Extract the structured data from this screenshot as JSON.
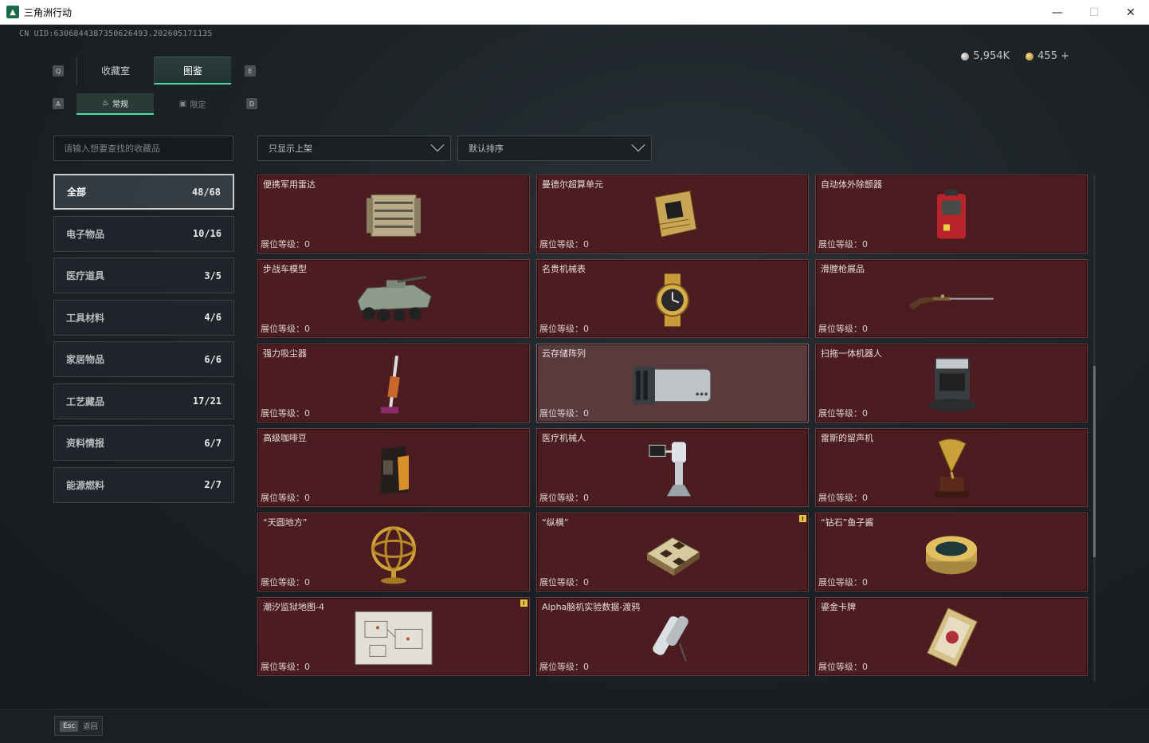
{
  "window": {
    "title": "三角洲行动"
  },
  "header": {
    "uid": "CN UID:6306844387350626493.202605171135",
    "currency": {
      "silver": "5,954K",
      "gold": "455 +"
    }
  },
  "key_hints": {
    "prev_tab": "Q",
    "next_tab": "E",
    "prev_sub": "A",
    "next_sub": "D"
  },
  "tabs": [
    {
      "label": "收藏室"
    },
    {
      "label": "图鉴"
    }
  ],
  "sub_tabs": [
    {
      "label": "常规"
    },
    {
      "label": "限定"
    }
  ],
  "search": {
    "placeholder": "请输入想要查找的收藏品"
  },
  "filters": {
    "shelf_filter": "只显示上架",
    "sort": "默认排序"
  },
  "categories": [
    {
      "label": "全部",
      "count": "48/68"
    },
    {
      "label": "电子物品",
      "count": "10/16"
    },
    {
      "label": "医疗道具",
      "count": "3/5"
    },
    {
      "label": "工具材料",
      "count": "4/6"
    },
    {
      "label": "家居物品",
      "count": "6/6"
    },
    {
      "label": "工艺藏品",
      "count": "17/21"
    },
    {
      "label": "资料情报",
      "count": "6/7"
    },
    {
      "label": "能源燃料",
      "count": "2/7"
    }
  ],
  "level_label": "展位等级：0",
  "items": [
    {
      "name": "便携军用雷达",
      "icon": "radar-icon"
    },
    {
      "name": "曼德尔超算单元",
      "icon": "chip-icon"
    },
    {
      "name": "自动体外除颤器",
      "icon": "defibrillator-icon"
    },
    {
      "name": "步战车模型",
      "icon": "ifv-model-icon"
    },
    {
      "name": "名贵机械表",
      "icon": "watch-icon"
    },
    {
      "name": "滑膛枪展品",
      "icon": "musket-icon"
    },
    {
      "name": "强力吸尘器",
      "icon": "vacuum-icon"
    },
    {
      "name": "云存储阵列",
      "icon": "storage-array-icon"
    },
    {
      "name": "扫拖一体机器人",
      "icon": "robot-mop-icon"
    },
    {
      "name": "高级咖啡豆",
      "icon": "coffee-bag-icon"
    },
    {
      "name": "医疗机械人",
      "icon": "medical-robot-icon"
    },
    {
      "name": "雷斯的留声机",
      "icon": "gramophone-icon"
    },
    {
      "name": "“天圆地方”",
      "icon": "armillary-icon"
    },
    {
      "name": "“纵横”",
      "icon": "chess-board-icon"
    },
    {
      "name": "“钻石”鱼子酱",
      "icon": "caviar-tin-icon"
    },
    {
      "name": "潮汐监狱地图-4",
      "icon": "map-icon"
    },
    {
      "name": "Alpha脑机实验数据-渡鸦",
      "icon": "data-drive-icon"
    },
    {
      "name": "鎏金卡牌",
      "icon": "golden-card-icon"
    }
  ],
  "bottom": {
    "esc_key": "Esc",
    "esc_label": "返回"
  },
  "colors": {
    "accent": "#3fe0a0",
    "card_bg": "#4c1d20",
    "badge": "#e8c040"
  }
}
